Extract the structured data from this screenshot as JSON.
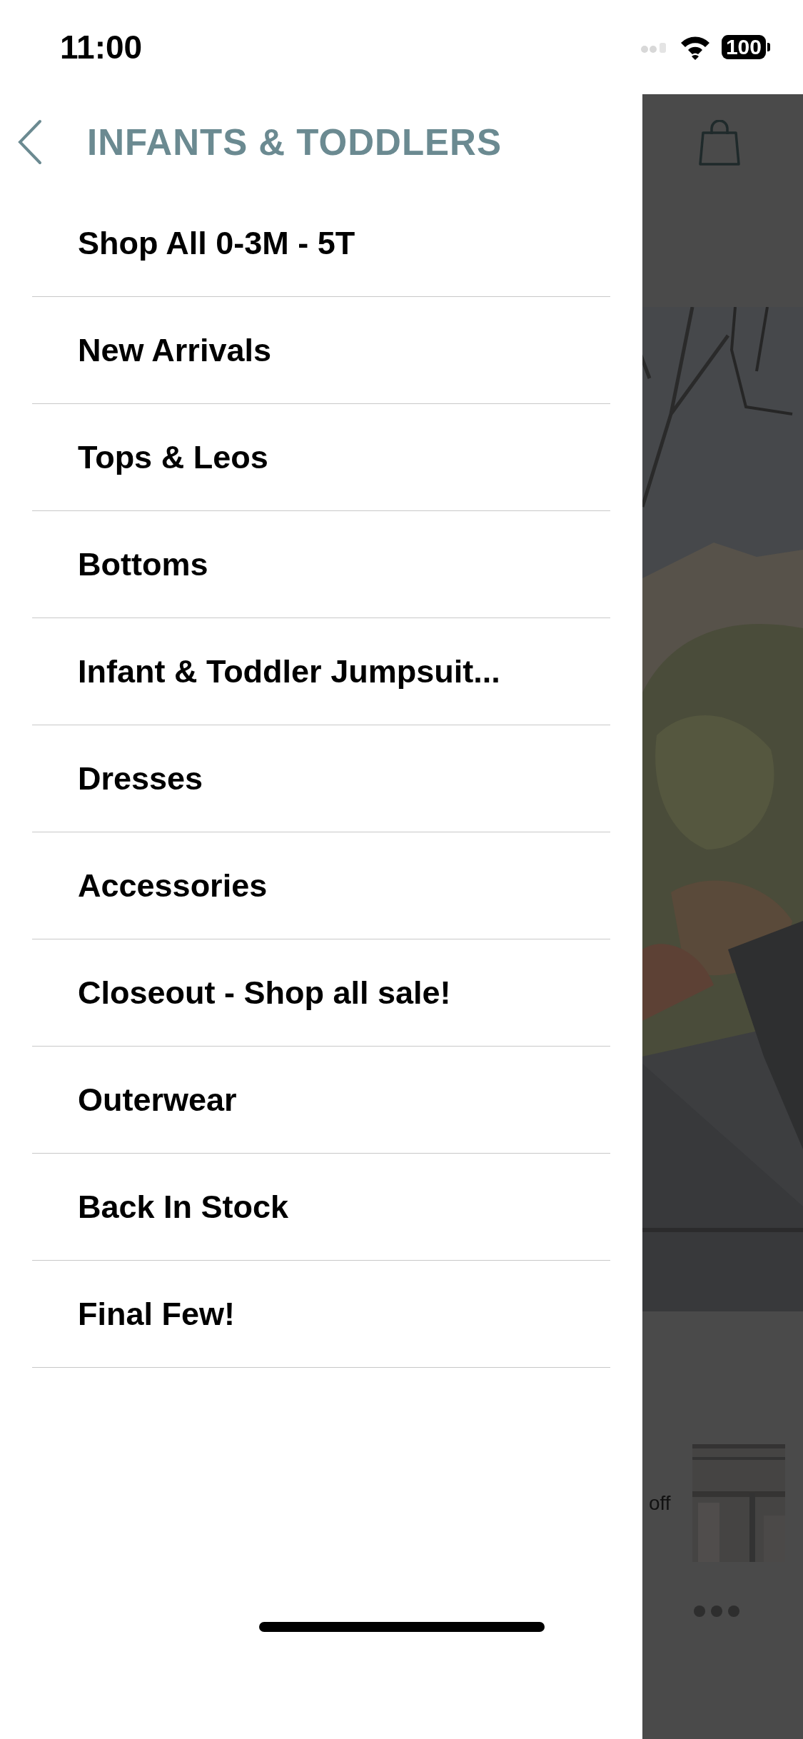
{
  "status_bar": {
    "time": "11:00",
    "battery": "100"
  },
  "menu": {
    "title": "INFANTS & TODDLERS",
    "items": [
      {
        "label": "Shop All 0-3M - 5T"
      },
      {
        "label": "New Arrivals"
      },
      {
        "label": "Tops & Leos"
      },
      {
        "label": "Bottoms"
      },
      {
        "label": "Infant & Toddler Jumpsuit..."
      },
      {
        "label": "Dresses"
      },
      {
        "label": "Accessories"
      },
      {
        "label": "Closeout - Shop all sale!"
      },
      {
        "label": "Outerwear"
      },
      {
        "label": "Back In Stock"
      },
      {
        "label": "Final Few!"
      }
    ]
  },
  "background_page": {
    "promo_text": "off"
  }
}
